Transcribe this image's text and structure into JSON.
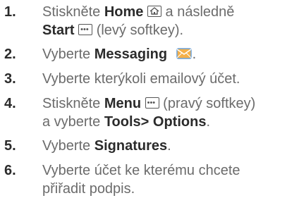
{
  "steps": [
    {
      "num": "1.",
      "l1_a": "Stiskněte ",
      "l1_b": "Home",
      "l1_c": " a následně",
      "l2_a": "Start",
      "l2_b": " (levý softkey)."
    },
    {
      "num": "2.",
      "a": "Vyberte ",
      "b": "Messaging",
      "c": "."
    },
    {
      "num": "3.",
      "a": "Vyberte kterýkoli emailový účet."
    },
    {
      "num": "4.",
      "l1_a": "Stiskněte ",
      "l1_b": "Menu",
      "l1_c": " (pravý softkey)",
      "l2_a": "a vyberte ",
      "l2_b": "Tools> Options",
      "l2_c": "."
    },
    {
      "num": "5.",
      "a": "Vyberte ",
      "b": "Signatures",
      "c": "."
    },
    {
      "num": "6.",
      "l1": "Vyberte účet ke kterému chcete",
      "l2": "přiřadit podpis."
    }
  ],
  "icons": [
    "home-key-icon",
    "softkey-icon",
    "messaging-envelope-icon"
  ],
  "colors": {
    "text": "#6b6b6b",
    "bold": "#2b2b2b",
    "envelope": "#f2a23a"
  }
}
